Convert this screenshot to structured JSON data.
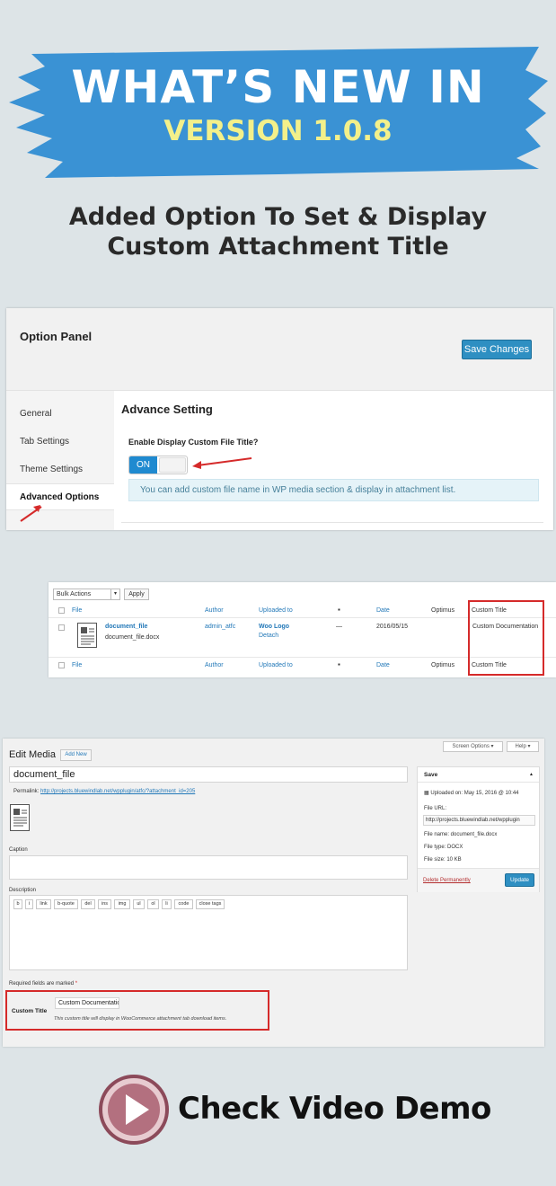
{
  "banner": {
    "title": "WHAT’S NEW IN",
    "version": "VERSION 1.0.8"
  },
  "subtitle": {
    "line1": "Added Option To Set & Display",
    "line2": "Custom Attachment Title"
  },
  "option_panel": {
    "title": "Option Panel",
    "save_label": "Save Changes",
    "sidebar": [
      "General",
      "Tab Settings",
      "Theme Settings",
      "Advanced Options"
    ],
    "section_title": "Advance Setting",
    "enable_label": "Enable Display Custom File Title?",
    "toggle_label": "ON",
    "info_text": "You can add custom file name in WP media section & display in attachment list."
  },
  "media_list": {
    "bulk_label": "Bulk Actions",
    "apply_label": "Apply",
    "columns": [
      "File",
      "Author",
      "Uploaded to",
      "Date",
      "Optimus",
      "Custom Title"
    ],
    "row": {
      "file_title": "document_file",
      "file_name": "document_file.docx",
      "author": "admin_atfc",
      "uploaded_to": "Woo Logo",
      "detach": "Detach",
      "comments": "—",
      "date": "2016/05/15",
      "custom_title": "Custom Documentation"
    }
  },
  "edit_media": {
    "title": "Edit Media",
    "add_new": "Add New",
    "screen_options": "Screen Options ▾",
    "help": "Help ▾",
    "file_title": "document_file",
    "permalink_label": "Permalink:",
    "permalink_url": "http://projects.bluewindlab.net/wpplugin/atfc/?attachment_id=205",
    "caption_label": "Caption",
    "description_label": "Description",
    "quicktags": [
      "b",
      "i",
      "link",
      "b-quote",
      "del",
      "ins",
      "img",
      "ul",
      "ol",
      "li",
      "code",
      "close tags"
    ],
    "required_note": "Required fields are marked",
    "required_star": "*",
    "custom_title_label": "Custom Title",
    "custom_title_value": "Custom Documentatic",
    "custom_title_help": "This custom title will display in WooCommerce attachment tab download items.",
    "save_box": {
      "heading": "Save",
      "uploaded_on": "Uploaded on: May 15, 2016 @ 10:44",
      "file_url_label": "File URL:",
      "file_url": "http://projects.bluewindlab.net/wpplugin",
      "file_name": "File name: document_file.docx",
      "file_type": "File type: DOCX",
      "file_size": "File size: 10 KB",
      "delete_label": "Delete Permanently",
      "update_label": "Update"
    }
  },
  "video": {
    "label": "Check Video Demo"
  },
  "colors": {
    "brand_blue": "#3a92d4",
    "version_yellow": "#f3f08a",
    "wp_button_blue": "#2e8fc2",
    "highlight_red": "#d52a2a",
    "play_button": "#b3707f"
  }
}
